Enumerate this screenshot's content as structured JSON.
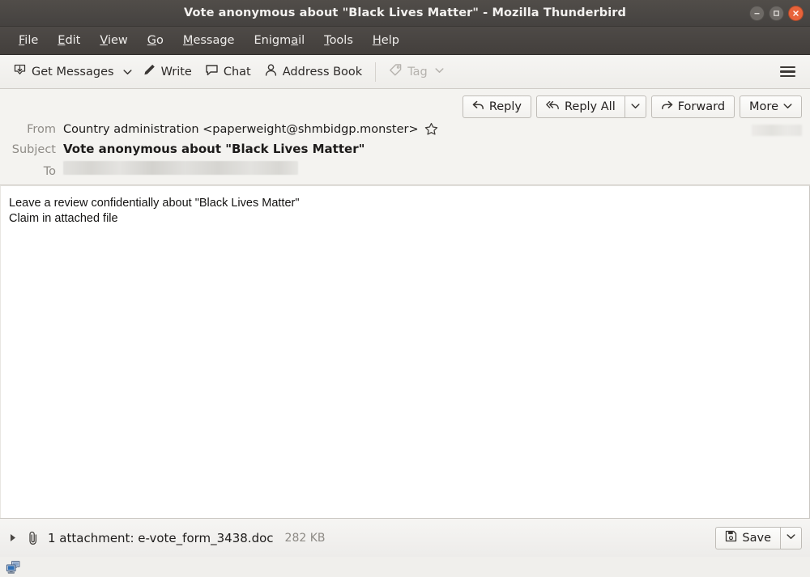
{
  "window": {
    "title": "Vote anonymous about \"Black Lives Matter\" - Mozilla Thunderbird",
    "controls": {
      "minimize": "minimize",
      "maximize": "maximize",
      "close": "close"
    }
  },
  "menubar": {
    "items": [
      {
        "label": "File",
        "accel": "F"
      },
      {
        "label": "Edit",
        "accel": "E"
      },
      {
        "label": "View",
        "accel": "V"
      },
      {
        "label": "Go",
        "accel": "G"
      },
      {
        "label": "Message",
        "accel": "M"
      },
      {
        "label": "Enigmail",
        "accel": "a"
      },
      {
        "label": "Tools",
        "accel": "T"
      },
      {
        "label": "Help",
        "accel": "H"
      }
    ]
  },
  "toolbar": {
    "get_messages_label": "Get Messages",
    "get_messages_icon": "inbox-download-icon",
    "get_messages_caret": "⌄",
    "write_label": "Write",
    "write_icon": "pencil-icon",
    "chat_label": "Chat",
    "chat_icon": "speech-bubble-icon",
    "address_book_label": "Address Book",
    "address_book_icon": "person-icon",
    "tag_label": "Tag",
    "tag_icon": "tag-icon",
    "tag_caret": "⌄",
    "tag_disabled": true,
    "app_menu_icon": "hamburger-icon"
  },
  "message_actions": {
    "reply_label": "Reply",
    "reply_icon": "reply-arrow-icon",
    "reply_all_label": "Reply All",
    "reply_all_icon": "reply-all-arrow-icon",
    "reply_all_caret": "⌄",
    "forward_label": "Forward",
    "forward_icon": "forward-arrow-icon",
    "more_label": "More",
    "more_caret": "⌄"
  },
  "message_header": {
    "from_label": "From",
    "from_value": "Country administration <paperweight@shmbidgp.monster>",
    "star_icon": "star-outline-icon",
    "subject_label": "Subject",
    "subject_value": "Vote anonymous about \"Black Lives Matter\"",
    "to_label": "To",
    "to_value": "",
    "to_redacted": true,
    "date_redacted": true
  },
  "message_body": {
    "lines": [
      "Leave a review confidentially about \"Black Lives Matter\"",
      "Claim in attached file"
    ]
  },
  "attachment_bar": {
    "twisty_icon": "triangle-right-icon",
    "clip_icon": "paperclip-icon",
    "label": "1 attachment: e-vote_form_3438.doc",
    "size": "282 KB",
    "save_label": "Save",
    "save_icon": "save-disk-icon",
    "save_caret": "⌄"
  },
  "statusbar": {
    "icon": "network-computers-icon"
  },
  "colors": {
    "titlebar_bg": "#4a4643",
    "close_button": "#e8633a",
    "toolbar_bg": "#f2f1ee",
    "header_bg": "#f4f3f0",
    "body_bg": "#ffffff",
    "label_text": "#8f8c87"
  }
}
